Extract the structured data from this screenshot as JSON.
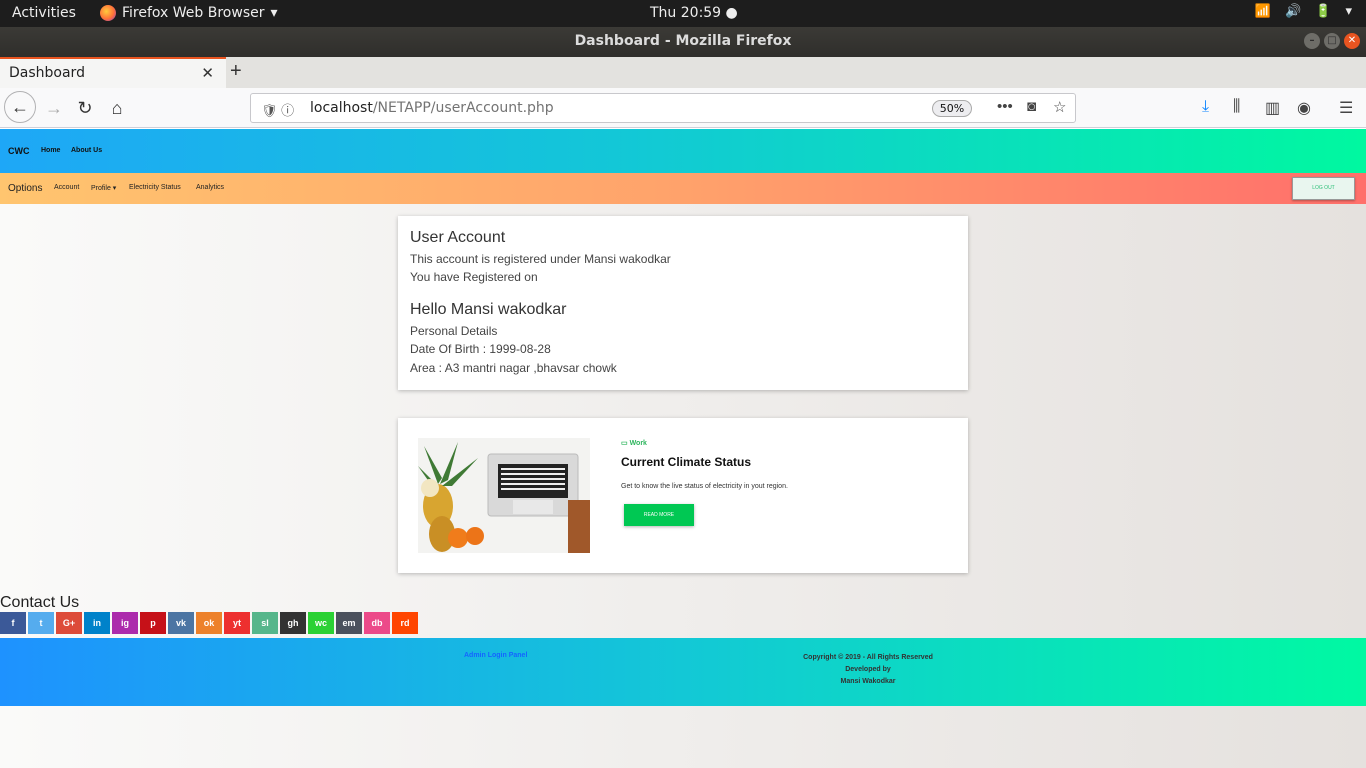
{
  "system": {
    "activities": "Activities",
    "app_name": "Firefox Web Browser",
    "clock": "Thu 20:59"
  },
  "window": {
    "title": "Dashboard - Mozilla Firefox"
  },
  "browser": {
    "tab_title": "Dashboard",
    "url_host": "localhost",
    "url_path": "/NETAPP/userAccount.php",
    "zoom": "50%"
  },
  "site": {
    "brand": "CWC",
    "nav": [
      "Home",
      "About Us"
    ],
    "options_label": "Options",
    "options": [
      "Account",
      "Profile ▾",
      "Electricity Status",
      "Analytics"
    ],
    "logout_label": "LOG OUT"
  },
  "account": {
    "title": "User Account",
    "registered_under": "This account is registered under Mansi wakodkar",
    "registered_on": "You have Registered on",
    "hello": "Hello Mansi wakodkar",
    "personal_details": "Personal Details",
    "dob": "Date Of Birth : 1999-08-28",
    "area": "Area : A3 mantri nagar ,bhavsar chowk"
  },
  "climate_card": {
    "category": "Work",
    "title": "Current Climate Status",
    "description": "Get to know the live status of electricity in yout region.",
    "button": "READ MORE"
  },
  "contact": {
    "title": "Contact Us",
    "socials": [
      {
        "icon": "f",
        "color": "#3b5998"
      },
      {
        "icon": "t",
        "color": "#55acee"
      },
      {
        "icon": "G+",
        "color": "#dd4b39"
      },
      {
        "icon": "in",
        "color": "#0082ca"
      },
      {
        "icon": "ig",
        "color": "#ac2bac"
      },
      {
        "icon": "p",
        "color": "#c61118"
      },
      {
        "icon": "vk",
        "color": "#4c75a3"
      },
      {
        "icon": "ok",
        "color": "#ed812b"
      },
      {
        "icon": "yt",
        "color": "#ed302f"
      },
      {
        "icon": "sl",
        "color": "#56b68b"
      },
      {
        "icon": "gh",
        "color": "#333333"
      },
      {
        "icon": "wc",
        "color": "#2bd134"
      },
      {
        "icon": "em",
        "color": "#4b515d"
      },
      {
        "icon": "db",
        "color": "#ec4a89"
      },
      {
        "icon": "rd",
        "color": "#ff4500"
      }
    ]
  },
  "footer": {
    "admin_link": "Admin Login Panel",
    "copyright": "Copyright © 2019 - All Rights Reserved",
    "developed_by": "Developed by",
    "developer": "Mansi Wakodkar"
  }
}
